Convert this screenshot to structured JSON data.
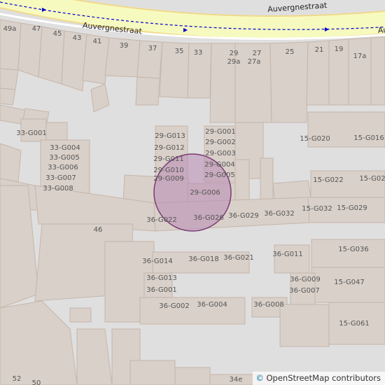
{
  "street_name": "Auvergnestraat",
  "attribution": {
    "symbol": "©",
    "text": "OpenStreetMap contributors"
  },
  "colors": {
    "background": "#e0dfdf",
    "building": "#d9d0c9",
    "road_outline": "#f0d98a",
    "road_fill": "#f7fabf",
    "route": "#0000cc",
    "highlight_fill": "#b88ab5",
    "highlight_stroke": "#7a3b75"
  },
  "labels": {
    "n49a": "49a",
    "n47": "47",
    "n45": "45",
    "n43": "43",
    "n41": "41",
    "n39": "39",
    "n37": "37",
    "n35": "35",
    "n33": "33",
    "n29": "29",
    "n29a": "29a",
    "n27": "27",
    "n27a": "27a",
    "n25": "25",
    "n21": "21",
    "n19": "19",
    "n17a": "17a",
    "n46": "46",
    "n52": "52",
    "n50": "50",
    "n34e": "34e",
    "g33_001": "33-G001",
    "g33_004": "33-G004",
    "g33_005": "33-G005",
    "g33_006": "33-G006",
    "g33_007": "33-G007",
    "g33_008": "33-G008",
    "g29_013": "29-G013",
    "g29_012": "29-G012",
    "g29_011": "29-G011",
    "g29_010": "29-G010",
    "g29_009": "29-G009",
    "g29_001": "29-G001",
    "g29_002": "29-G002",
    "g29_003": "29-G003",
    "g29_004": "29-G004",
    "g29_005": "29-G005",
    "g29_006": "29-G006",
    "g36_022": "36-G022",
    "g36_026": "36-G026",
    "g36_029": "36-G029",
    "g36_032": "36-G032",
    "g36_014": "36-G014",
    "g36_018": "36-G018",
    "g36_021": "36-G021",
    "g36_013": "36-G013",
    "g36_001": "36-G001",
    "g36_002": "36-G002",
    "g36_004": "36-G004",
    "g36_011": "36-G011",
    "g36_009": "36-G009",
    "g36_007": "36-G007",
    "g36_008": "36-G008",
    "g15_020": "15-G020",
    "g15_016": "15-G016",
    "g15_022": "15-G022",
    "g15_02x": "15-G02",
    "g15_032": "15-G032",
    "g15_029": "15-G029",
    "g15_036": "15-G036",
    "g15_047": "15-G047",
    "g15_061": "15-G061"
  }
}
